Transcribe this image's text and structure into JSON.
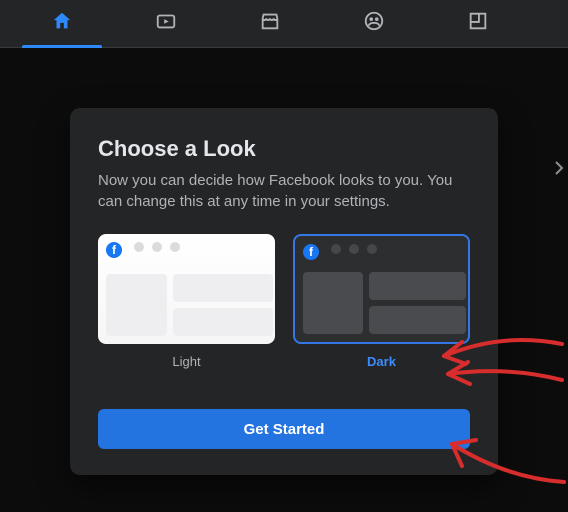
{
  "nav": {
    "items": [
      {
        "name": "home",
        "active": true
      },
      {
        "name": "watch",
        "active": false
      },
      {
        "name": "market",
        "active": false
      },
      {
        "name": "groups",
        "active": false
      },
      {
        "name": "gaming",
        "active": false
      }
    ]
  },
  "modal": {
    "title": "Choose a Look",
    "description": "Now you can decide how Facebook looks to you. You can change this at any time in your settings.",
    "options": {
      "light": {
        "label": "Light"
      },
      "dark": {
        "label": "Dark",
        "selected": true
      }
    },
    "cta_label": "Get Started"
  },
  "colors": {
    "accent": "#2374e1",
    "link": "#3d8cff",
    "bg": "#18191a",
    "surface": "#242526"
  }
}
